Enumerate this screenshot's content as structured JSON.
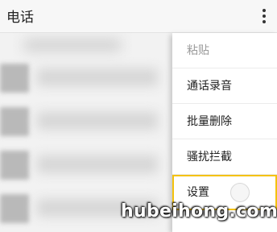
{
  "app_bar": {
    "title": "电话"
  },
  "menu": {
    "items": [
      {
        "label": "粘贴",
        "enabled": false
      },
      {
        "label": "通话录音",
        "enabled": true
      },
      {
        "label": "批量删除",
        "enabled": true
      },
      {
        "label": "骚扰拦截",
        "enabled": true
      },
      {
        "label": "设置",
        "enabled": true,
        "highlighted": true
      }
    ]
  },
  "watermark": {
    "text": "hubeihong.com"
  },
  "colors": {
    "highlight_border": "#f4c20d"
  }
}
